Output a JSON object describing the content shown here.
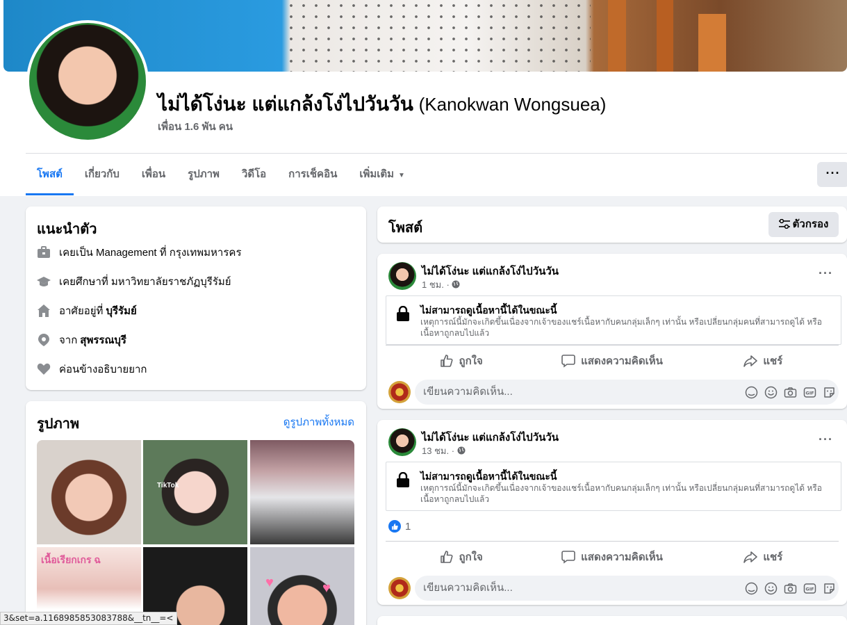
{
  "profile": {
    "name": "ไม่ได้โง่นะ แต่แกล้งโง่ไปวันวัน",
    "alt_name": "(Kanokwan Wongsuea)",
    "friends": "เพื่อน 1.6 พัน คน"
  },
  "tabs": [
    {
      "label": "โพสต์"
    },
    {
      "label": "เกี่ยวกับ"
    },
    {
      "label": "เพื่อน"
    },
    {
      "label": "รูปภาพ"
    },
    {
      "label": "วิดีโอ"
    },
    {
      "label": "การเช็คอิน"
    },
    {
      "label": "เพิ่มเติม"
    }
  ],
  "more_button": "···",
  "intro": {
    "title": "แนะนำตัว",
    "items": [
      {
        "icon": "briefcase-icon",
        "text": "เคยเป็น Management ที่ กรุงเทพมหารคร",
        "bold": ""
      },
      {
        "icon": "graduation-cap-icon",
        "text": "เคยศึกษาที่ มหาวิทยาลัยราชภัฏบุรีรัมย์",
        "bold": ""
      },
      {
        "icon": "home-icon",
        "text": "อาศัยอยู่ที่",
        "bold": "บุรีรัมย์"
      },
      {
        "icon": "location-pin-icon",
        "text": "จาก",
        "bold": "สุพรรณบุรี"
      },
      {
        "icon": "heart-icon",
        "text": "ค่อนข้างอธิบายยาก",
        "bold": ""
      }
    ]
  },
  "photos": {
    "title": "รูปภาพ",
    "see_all": "ดูรูปภาพทั้งหมด",
    "tiktok_label": "TikTok",
    "frame_text": "เนื้อเรียกเกร ฉ"
  },
  "posts_header": {
    "title": "โพสต์",
    "filter_label": "ตัวกรอง"
  },
  "posts": [
    {
      "author": "ไม่ได้โง่นะ แต่แกล้งโง่ไปวันวัน",
      "time": "1 ชม. ·",
      "locked_title": "ไม่สามารถดูเนื้อหานี้ได้ในขณะนี้",
      "locked_desc": "เหตุการณ์นี้มักจะเกิดขึ้นเนื่องจากเจ้าของแชร์เนื้อหากับคนกลุ่มเล็กๆ เท่านั้น หรือเปลี่ยนกลุ่มคนที่สามารถดูได้ หรือเนื้อหาถูกลบไปแล้ว",
      "likes": "",
      "like_label": "ถูกใจ",
      "comment_label": "แสดงความคิดเห็น",
      "share_label": "แชร์",
      "comment_placeholder": "เขียนความคิดเห็น..."
    },
    {
      "author": "ไม่ได้โง่นะ แต่แกล้งโง่ไปวันวัน",
      "time": "13 ชม. ·",
      "locked_title": "ไม่สามารถดูเนื้อหานี้ได้ในขณะนี้",
      "locked_desc": "เหตุการณ์นี้มักจะเกิดขึ้นเนื่องจากเจ้าของแชร์เนื้อหากับคนกลุ่มเล็กๆ เท่านั้น หรือเปลี่ยนกลุ่มคนที่สามารถดูได้ หรือเนื้อหาถูกลบไปแล้ว",
      "likes": "1",
      "like_label": "ถูกใจ",
      "comment_label": "แสดงความคิดเห็น",
      "share_label": "แชร์",
      "comment_placeholder": "เขียนความคิดเห็น..."
    }
  ],
  "status_bar": "3&set=a.1168985853083788&__tn__=<",
  "colors": {
    "accent": "#1877f2",
    "background": "#f0f2f5",
    "secondary_text": "#65676b"
  }
}
